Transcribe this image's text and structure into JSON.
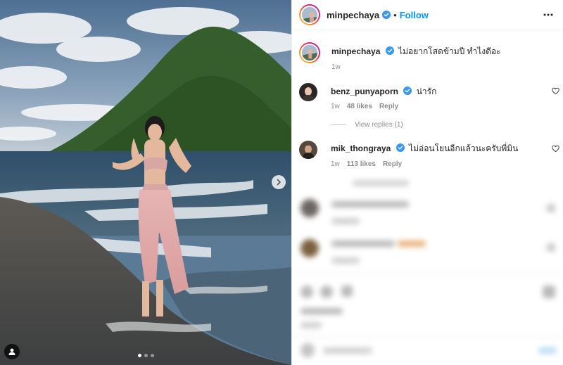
{
  "post": {
    "author": "minpechaya",
    "follow_label": "Follow",
    "caption": "ไม่อยากโสดข้ามปี ทำไงดีอะ",
    "caption_time": "1w",
    "carousel": {
      "total_slides": 3,
      "active_index": 0
    }
  },
  "comments": [
    {
      "username": "benz_punyaporn",
      "verified": true,
      "text": "น่ารัก",
      "time": "1w",
      "likes": "48 likes",
      "reply_label": "Reply",
      "view_replies": "View replies (1)"
    },
    {
      "username": "mik_thongraya",
      "verified": true,
      "text": "ไม่อ่อนโยนอีกแล้วนะครับพี่มิน",
      "time": "1w",
      "likes": "113 likes",
      "reply_label": "Reply"
    }
  ],
  "colors": {
    "follow": "#0095f6",
    "verified": "#3897f0",
    "muted": "#8e8e8e"
  },
  "icons": [
    "verified-badge-icon",
    "more-options-icon",
    "heart-icon",
    "chevron-right-icon",
    "user-tag-icon"
  ]
}
